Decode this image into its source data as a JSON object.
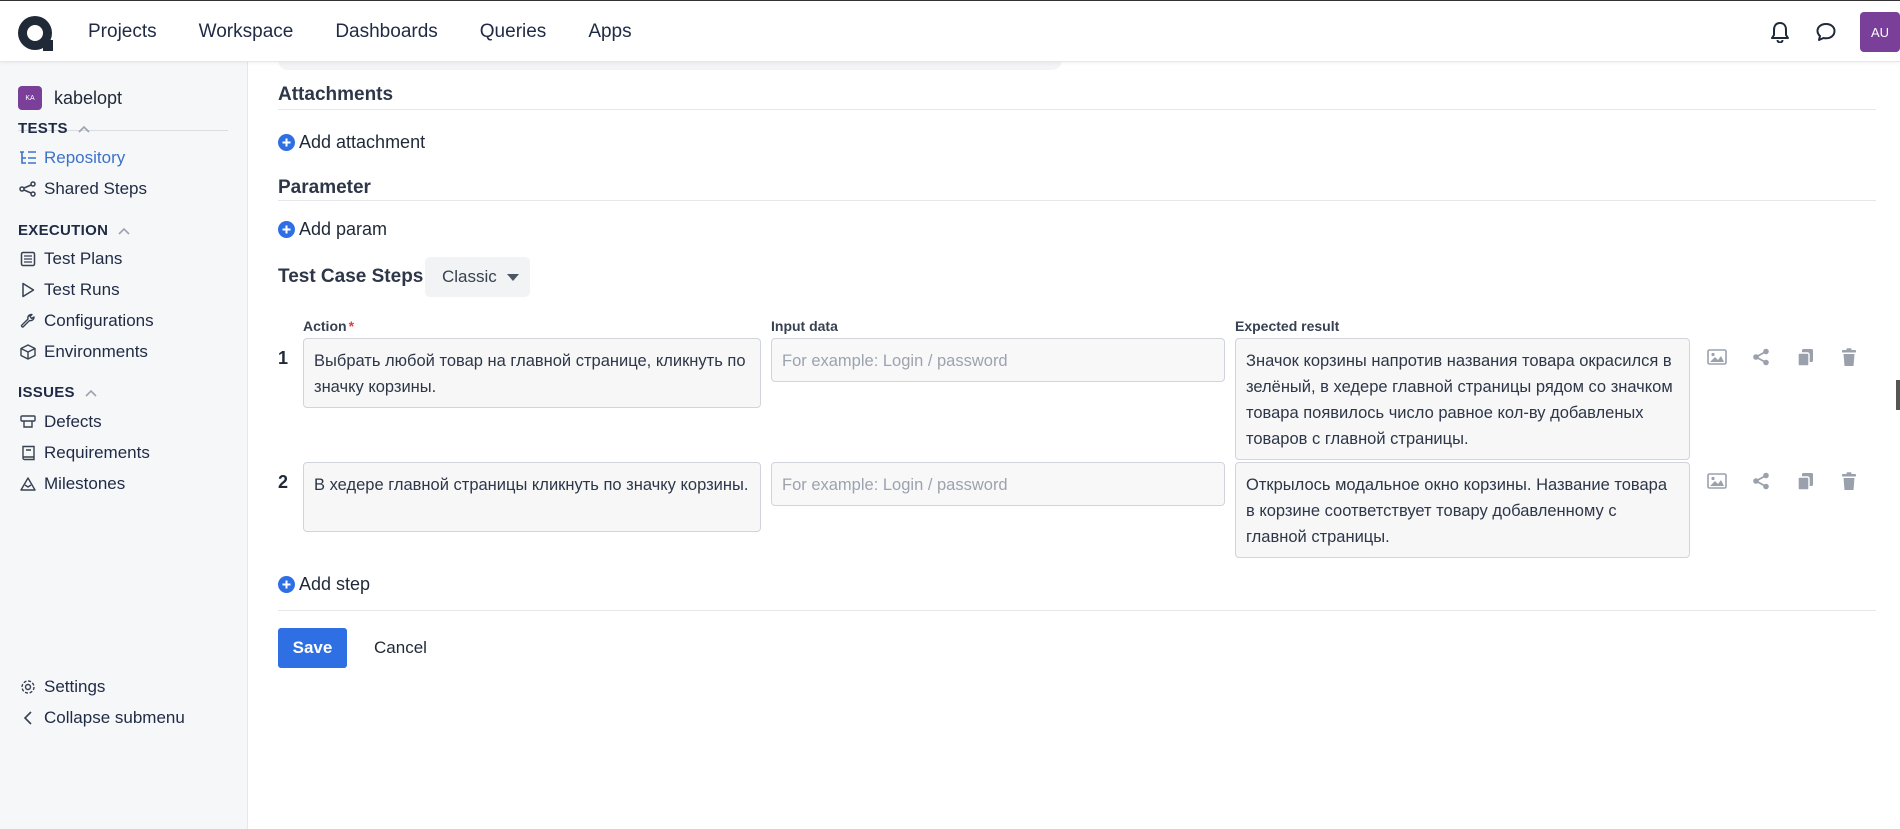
{
  "nav": {
    "items": [
      "Projects",
      "Workspace",
      "Dashboards",
      "Queries",
      "Apps"
    ],
    "avatar_initials": "AU"
  },
  "sidebar": {
    "project_badge": "KA",
    "project_name": "kabelopt",
    "tests_title": "TESTS",
    "repository": "Repository",
    "shared_steps": "Shared Steps",
    "execution_title": "EXECUTION",
    "test_plans": "Test Plans",
    "test_runs": "Test Runs",
    "configurations": "Configurations",
    "environments": "Environments",
    "issues_title": "ISSUES",
    "defects": "Defects",
    "requirements": "Requirements",
    "milestones": "Milestones",
    "settings": "Settings",
    "collapse": "Collapse submenu"
  },
  "main": {
    "attachments_title": "Attachments",
    "add_attachment": "Add attachment",
    "parameter_title": "Parameter",
    "add_param": "Add param",
    "steps_title": "Test Case Steps",
    "steps_mode": "Classic",
    "col_action": "Action",
    "col_action_required": "*",
    "col_input": "Input data",
    "col_expected": "Expected result",
    "steps": [
      {
        "num": "1",
        "action": "Выбрать любой товар на главной странице, кликнуть по значку корзины.",
        "input_placeholder": "For example: Login / password",
        "expected": "Значок корзины напротив названия товара окрасился в зелёный, в хедере главной страницы рядом со значком товара появилось число равное кол-ву добавленых товаров с главной страницы."
      },
      {
        "num": "2",
        "action": "В хедере главной страницы кликнуть по значку корзины.",
        "input_placeholder": "For example: Login / password",
        "expected": "Открылось модальное окно корзины. Название товара в корзине соответствует товару добавленному с главной страницы."
      }
    ],
    "add_step": "Add step",
    "save": "Save",
    "cancel": "Cancel"
  },
  "colors": {
    "accent": "#2f6fe4",
    "active_link": "#3b73c9",
    "avatar": "#7a3f98"
  }
}
